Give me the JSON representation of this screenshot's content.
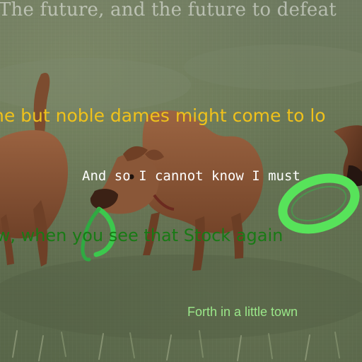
{
  "image": {
    "subject": "three brown dogs playing with green rings on grass",
    "colors": {
      "grass": "#5f6d4f",
      "dog_fur": "#8a5636",
      "ring": "#57e35a"
    }
  },
  "captions": {
    "top": "The future, and the future to defeat",
    "upper_middle": "ne but noble dames might come to lo",
    "middle": "And so I cannot know I must",
    "lower_middle": "ow, when you see that Stock again",
    "bottom": "Forth in a little town"
  }
}
